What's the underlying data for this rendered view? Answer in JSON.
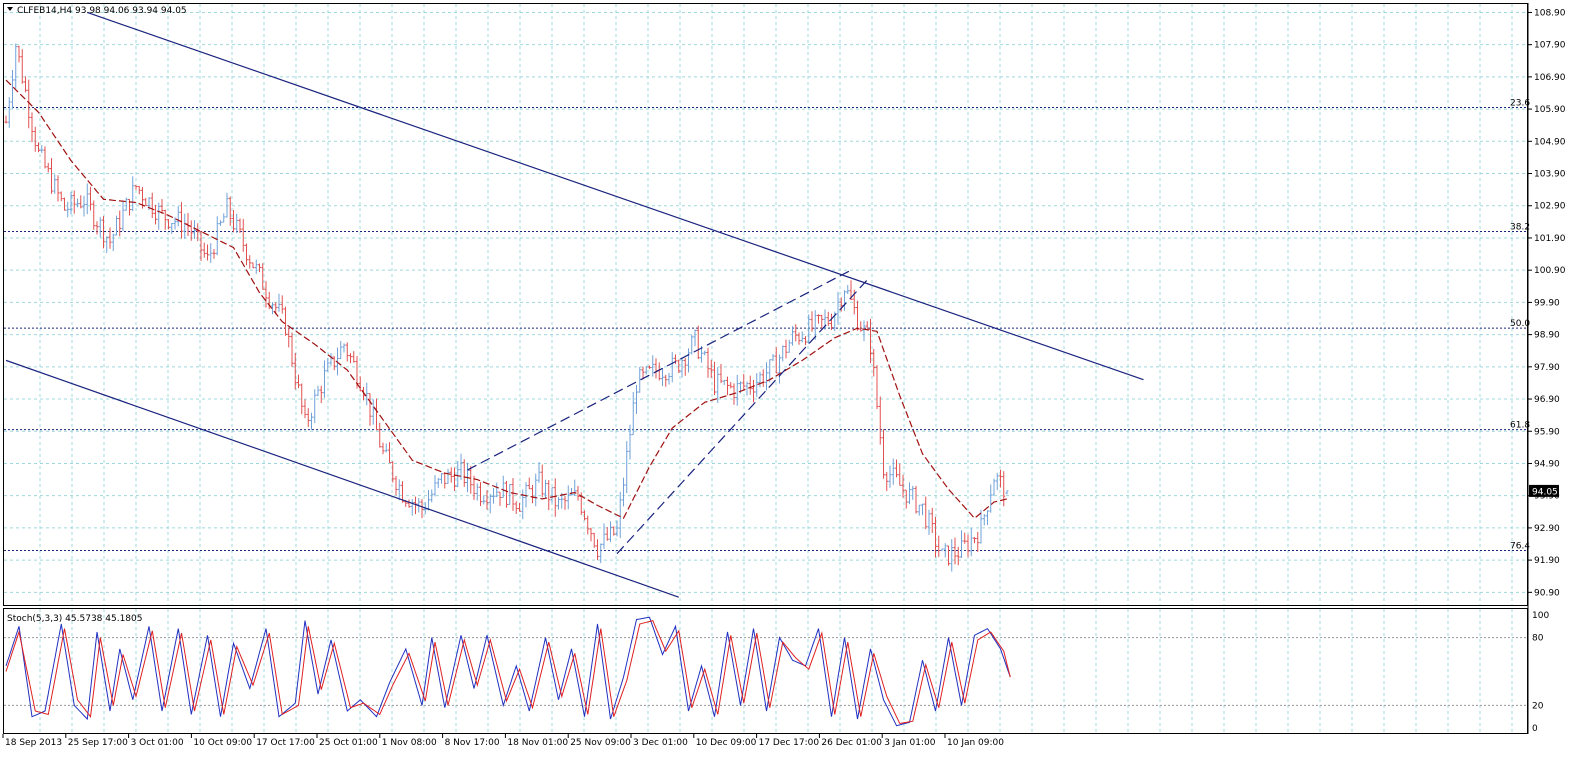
{
  "colors": {
    "background": "#ffffff",
    "grid": "#9fd8dc",
    "bull_candle": "#6fa0d8",
    "bear_candle": "#e05050",
    "moving_average": "#a01010",
    "channel": "#1a237e",
    "fibonacci": "#1a237e",
    "stoch_main": "#2030c0",
    "stoch_signal": "#e02020",
    "price_tag_bg": "#000000",
    "price_tag_text": "#ffffff"
  },
  "header": {
    "label": "CLFEB14,H4  93.98 94.06 93.94 94.05",
    "menu_icon": "triangle-down-icon"
  },
  "price_tag": "94.05",
  "stoch_label": "Stoch(5,3,3) 45.5738 45.1805",
  "chart_data": [
    {
      "type": "candlestick",
      "title": "CLFEB14,H4",
      "ohlc_current": {
        "open": 93.98,
        "high": 94.06,
        "low": 93.94,
        "close": 94.05
      },
      "ylim": [
        90.6,
        109.1
      ],
      "y_ticks": [
        "108.90",
        "107.90",
        "106.90",
        "105.90",
        "104.90",
        "103.90",
        "102.90",
        "101.90",
        "100.90",
        "99.90",
        "98.90",
        "97.90",
        "96.90",
        "95.90",
        "94.90",
        "93.90",
        "92.90",
        "91.90",
        "90.90"
      ],
      "x_ticks": [
        "18 Sep 2013",
        "25 Sep 17:00",
        "3 Oct 01:00",
        "10 Oct 09:00",
        "17 Oct 17:00",
        "25 Oct 01:00",
        "1 Nov 08:00",
        "8 Nov 17:00",
        "18 Nov 01:00",
        "25 Nov 09:00",
        "3 Dec 01:00",
        "10 Dec 09:00",
        "17 Dec 17:00",
        "26 Dec 01:00",
        "3 Jan 01:00",
        "10 Jan 09:00"
      ],
      "close_keypoints": [
        [
          0,
          105.5
        ],
        [
          3,
          107.9
        ],
        [
          10,
          104.5
        ],
        [
          18,
          102.8
        ],
        [
          24,
          103.1
        ],
        [
          32,
          101.8
        ],
        [
          40,
          103.5
        ],
        [
          48,
          102.6
        ],
        [
          56,
          102.3
        ],
        [
          62,
          101.2
        ],
        [
          68,
          102.8
        ],
        [
          75,
          101.3
        ],
        [
          80,
          100.3
        ],
        [
          86,
          99.2
        ],
        [
          92,
          96.1
        ],
        [
          98,
          97.6
        ],
        [
          104,
          98.6
        ],
        [
          110,
          97.3
        ],
        [
          116,
          95.2
        ],
        [
          122,
          94.0
        ],
        [
          128,
          93.5
        ],
        [
          134,
          94.4
        ],
        [
          140,
          94.6
        ],
        [
          146,
          94.0
        ],
        [
          152,
          94.1
        ],
        [
          158,
          93.7
        ],
        [
          164,
          94.3
        ],
        [
          170,
          93.6
        ],
        [
          176,
          93.9
        ],
        [
          182,
          92.3
        ],
        [
          188,
          92.8
        ],
        [
          194,
          97.4
        ],
        [
          200,
          97.8
        ],
        [
          206,
          97.9
        ],
        [
          212,
          98.7
        ],
        [
          218,
          97.4
        ],
        [
          224,
          97.2
        ],
        [
          230,
          97.4
        ],
        [
          236,
          97.9
        ],
        [
          242,
          98.8
        ],
        [
          248,
          99.1
        ],
        [
          254,
          99.4
        ],
        [
          258,
          100.4
        ],
        [
          262,
          99.4
        ],
        [
          266,
          98.6
        ],
        [
          270,
          94.8
        ],
        [
          276,
          94.1
        ],
        [
          282,
          93.5
        ],
        [
          288,
          92.0
        ],
        [
          294,
          92.2
        ],
        [
          300,
          92.9
        ],
        [
          304,
          94.5
        ],
        [
          308,
          94.05
        ]
      ],
      "moving_average_keypoints": [
        [
          0,
          106.8
        ],
        [
          10,
          105.8
        ],
        [
          20,
          104.3
        ],
        [
          30,
          103.1
        ],
        [
          40,
          103.0
        ],
        [
          50,
          102.6
        ],
        [
          60,
          102.1
        ],
        [
          70,
          101.6
        ],
        [
          78,
          100.2
        ],
        [
          85,
          99.3
        ],
        [
          95,
          98.6
        ],
        [
          105,
          97.8
        ],
        [
          115,
          96.4
        ],
        [
          125,
          95.0
        ],
        [
          135,
          94.6
        ],
        [
          145,
          94.4
        ],
        [
          155,
          94.0
        ],
        [
          165,
          93.8
        ],
        [
          175,
          94.0
        ],
        [
          182,
          93.6
        ],
        [
          190,
          93.2
        ],
        [
          198,
          94.8
        ],
        [
          205,
          96.0
        ],
        [
          215,
          96.8
        ],
        [
          225,
          97.1
        ],
        [
          235,
          97.5
        ],
        [
          245,
          98.1
        ],
        [
          255,
          98.8
        ],
        [
          262,
          99.1
        ],
        [
          268,
          99.0
        ],
        [
          275,
          97.0
        ],
        [
          282,
          95.2
        ],
        [
          290,
          94.1
        ],
        [
          298,
          93.2
        ],
        [
          304,
          93.7
        ],
        [
          308,
          93.8
        ]
      ],
      "fibonacci_levels": [
        {
          "label": "23.6",
          "value": 105.95
        },
        {
          "label": "38.2",
          "value": 102.1
        },
        {
          "label": "50.0",
          "value": 99.1
        },
        {
          "label": "61.8",
          "value": 95.95
        },
        {
          "label": "76.4",
          "value": 92.2
        }
      ],
      "trendlines": [
        {
          "style": "solid",
          "from": [
            25,
            108.9
          ],
          "to": [
            350,
            97.5
          ]
        },
        {
          "style": "solid",
          "from": [
            0,
            98.1
          ],
          "to": [
            207,
            90.75
          ]
        },
        {
          "style": "dashed",
          "from": [
            142,
            94.7
          ],
          "to": [
            260,
            100.9
          ]
        },
        {
          "style": "dashed",
          "from": [
            188,
            92.1
          ],
          "to": [
            265,
            100.6
          ]
        }
      ]
    },
    {
      "type": "line",
      "title": "Stoch(5,3,3)",
      "ylim": [
        0,
        100
      ],
      "y_ticks": [
        "100",
        "80",
        "20",
        "0"
      ],
      "series": [
        {
          "name": "45.5738",
          "role": "main",
          "keypoints": [
            [
              0,
              55
            ],
            [
              4,
              90
            ],
            [
              8,
              10
            ],
            [
              12,
              15
            ],
            [
              17,
              92
            ],
            [
              21,
              20
            ],
            [
              25,
              8
            ],
            [
              28,
              85
            ],
            [
              32,
              15
            ],
            [
              35,
              70
            ],
            [
              39,
              25
            ],
            [
              44,
              90
            ],
            [
              48,
              15
            ],
            [
              53,
              88
            ],
            [
              57,
              12
            ],
            [
              62,
              82
            ],
            [
              66,
              10
            ],
            [
              70,
              75
            ],
            [
              75,
              35
            ],
            [
              80,
              88
            ],
            [
              84,
              10
            ],
            [
              89,
              22
            ],
            [
              92,
              95
            ],
            [
              96,
              30
            ],
            [
              100,
              78
            ],
            [
              105,
              15
            ],
            [
              109,
              25
            ],
            [
              114,
              10
            ],
            [
              118,
              40
            ],
            [
              123,
              70
            ],
            [
              128,
              20
            ],
            [
              131,
              80
            ],
            [
              135,
              18
            ],
            [
              140,
              82
            ],
            [
              144,
              35
            ],
            [
              148,
              82
            ],
            [
              153,
              20
            ],
            [
              157,
              55
            ],
            [
              161,
              15
            ],
            [
              166,
              80
            ],
            [
              170,
              25
            ],
            [
              174,
              70
            ],
            [
              178,
              10
            ],
            [
              182,
              92
            ],
            [
              186,
              8
            ],
            [
              190,
              45
            ],
            [
              194,
              96
            ],
            [
              198,
              98
            ],
            [
              202,
              65
            ],
            [
              206,
              90
            ],
            [
              210,
              15
            ],
            [
              214,
              55
            ],
            [
              218,
              10
            ],
            [
              222,
              85
            ],
            [
              226,
              20
            ],
            [
              230,
              88
            ],
            [
              234,
              15
            ],
            [
              238,
              80
            ],
            [
              242,
              60
            ],
            [
              246,
              55
            ],
            [
              250,
              88
            ],
            [
              254,
              10
            ],
            [
              258,
              80
            ],
            [
              262,
              8
            ],
            [
              266,
              70
            ],
            [
              270,
              25
            ],
            [
              274,
              2
            ],
            [
              278,
              5
            ],
            [
              282,
              60
            ],
            [
              286,
              15
            ],
            [
              290,
              80
            ],
            [
              294,
              20
            ],
            [
              298,
              82
            ],
            [
              302,
              88
            ],
            [
              306,
              70
            ],
            [
              309,
              45
            ]
          ]
        },
        {
          "name": "45.1805",
          "role": "signal",
          "keypoints": [
            [
              0,
              50
            ],
            [
              4,
              85
            ],
            [
              9,
              15
            ],
            [
              13,
              12
            ],
            [
              18,
              88
            ],
            [
              22,
              25
            ],
            [
              26,
              10
            ],
            [
              29,
              80
            ],
            [
              33,
              20
            ],
            [
              36,
              65
            ],
            [
              40,
              28
            ],
            [
              45,
              86
            ],
            [
              49,
              18
            ],
            [
              54,
              84
            ],
            [
              58,
              15
            ],
            [
              63,
              78
            ],
            [
              67,
              12
            ],
            [
              71,
              72
            ],
            [
              76,
              38
            ],
            [
              81,
              84
            ],
            [
              85,
              12
            ],
            [
              90,
              20
            ],
            [
              93,
              90
            ],
            [
              97,
              34
            ],
            [
              101,
              75
            ],
            [
              106,
              18
            ],
            [
              110,
              22
            ],
            [
              115,
              12
            ],
            [
              119,
              38
            ],
            [
              124,
              66
            ],
            [
              129,
              24
            ],
            [
              132,
              76
            ],
            [
              136,
              20
            ],
            [
              141,
              78
            ],
            [
              145,
              38
            ],
            [
              149,
              78
            ],
            [
              154,
              24
            ],
            [
              158,
              52
            ],
            [
              162,
              18
            ],
            [
              167,
              76
            ],
            [
              171,
              28
            ],
            [
              175,
              66
            ],
            [
              179,
              12
            ],
            [
              183,
              88
            ],
            [
              187,
              10
            ],
            [
              191,
              42
            ],
            [
              195,
              92
            ],
            [
              199,
              95
            ],
            [
              203,
              68
            ],
            [
              207,
              86
            ],
            [
              211,
              18
            ],
            [
              215,
              52
            ],
            [
              219,
              12
            ],
            [
              223,
              82
            ],
            [
              227,
              22
            ],
            [
              231,
              84
            ],
            [
              235,
              18
            ],
            [
              239,
              76
            ],
            [
              243,
              62
            ],
            [
              247,
              52
            ],
            [
              251,
              84
            ],
            [
              255,
              12
            ],
            [
              259,
              76
            ],
            [
              263,
              10
            ],
            [
              267,
              66
            ],
            [
              271,
              28
            ],
            [
              275,
              4
            ],
            [
              279,
              6
            ],
            [
              283,
              56
            ],
            [
              287,
              18
            ],
            [
              291,
              76
            ],
            [
              295,
              22
            ],
            [
              299,
              78
            ],
            [
              303,
              85
            ],
            [
              307,
              68
            ],
            [
              309,
              45
            ]
          ]
        }
      ]
    }
  ]
}
